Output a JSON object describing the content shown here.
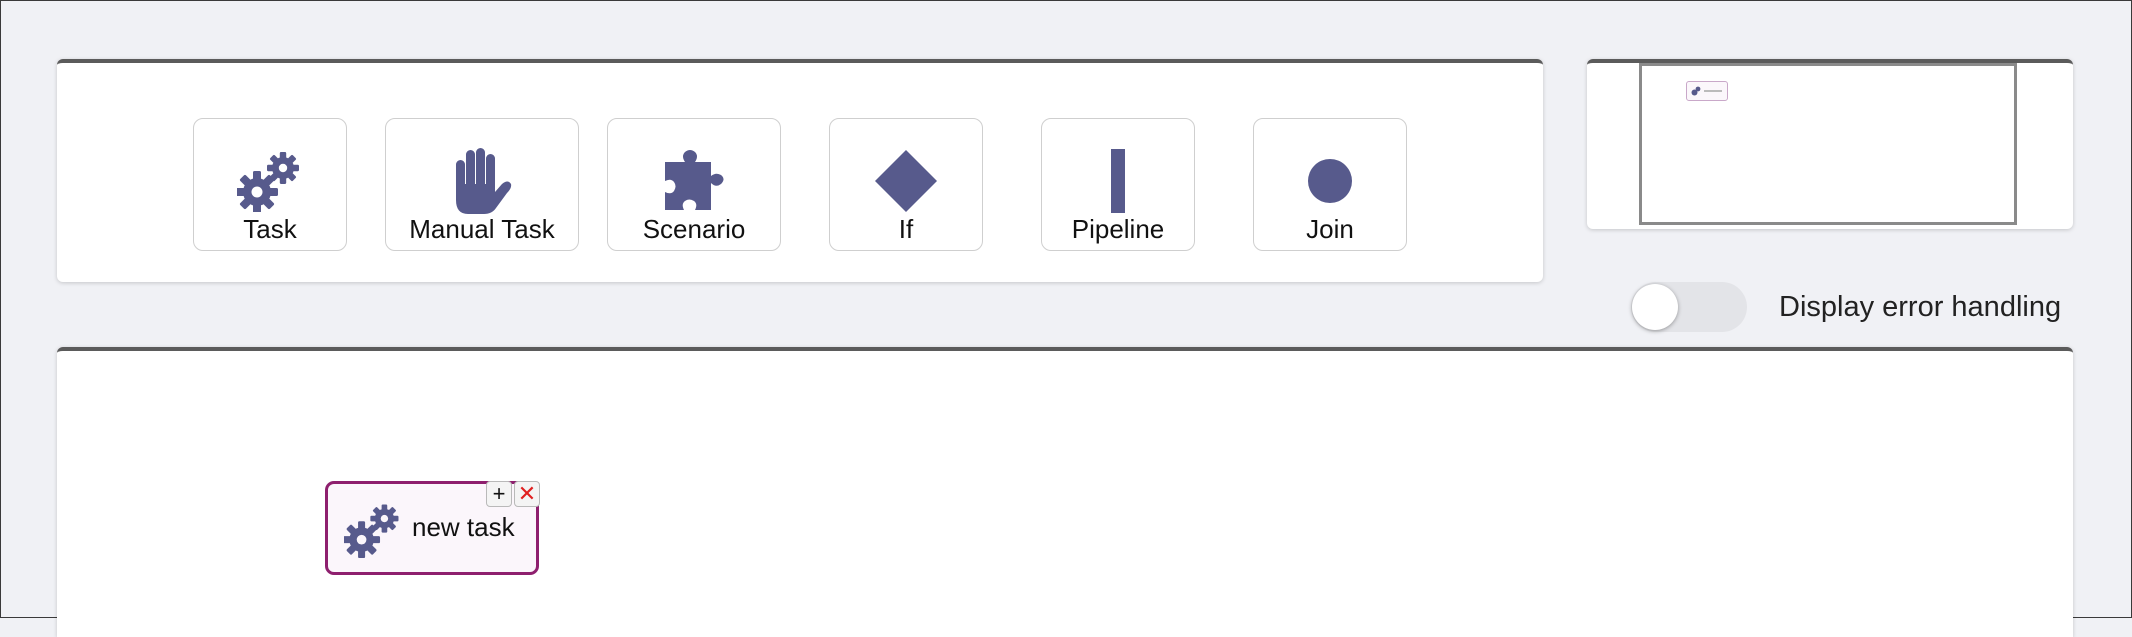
{
  "palette": {
    "items": [
      {
        "label": "Task",
        "icon": "gears-icon"
      },
      {
        "label": "Manual Task",
        "icon": "hand-icon"
      },
      {
        "label": "Scenario",
        "icon": "puzzle-icon"
      },
      {
        "label": "If",
        "icon": "diamond-icon"
      },
      {
        "label": "Pipeline",
        "icon": "bar-icon"
      },
      {
        "label": "Join",
        "icon": "circle-icon"
      }
    ]
  },
  "settings": {
    "error_handling_label": "Display error handling",
    "error_handling_enabled": false
  },
  "canvas": {
    "nodes": [
      {
        "label": "new task",
        "icon": "gears-icon",
        "add_symbol": "+",
        "delete_symbol": "✕"
      }
    ]
  },
  "colors": {
    "icon": "#575a8c",
    "node_border": "#8e1f6e",
    "delete": "#e02020",
    "panel_top_border": "#5b5b5b",
    "background": "#f0f1f5"
  }
}
